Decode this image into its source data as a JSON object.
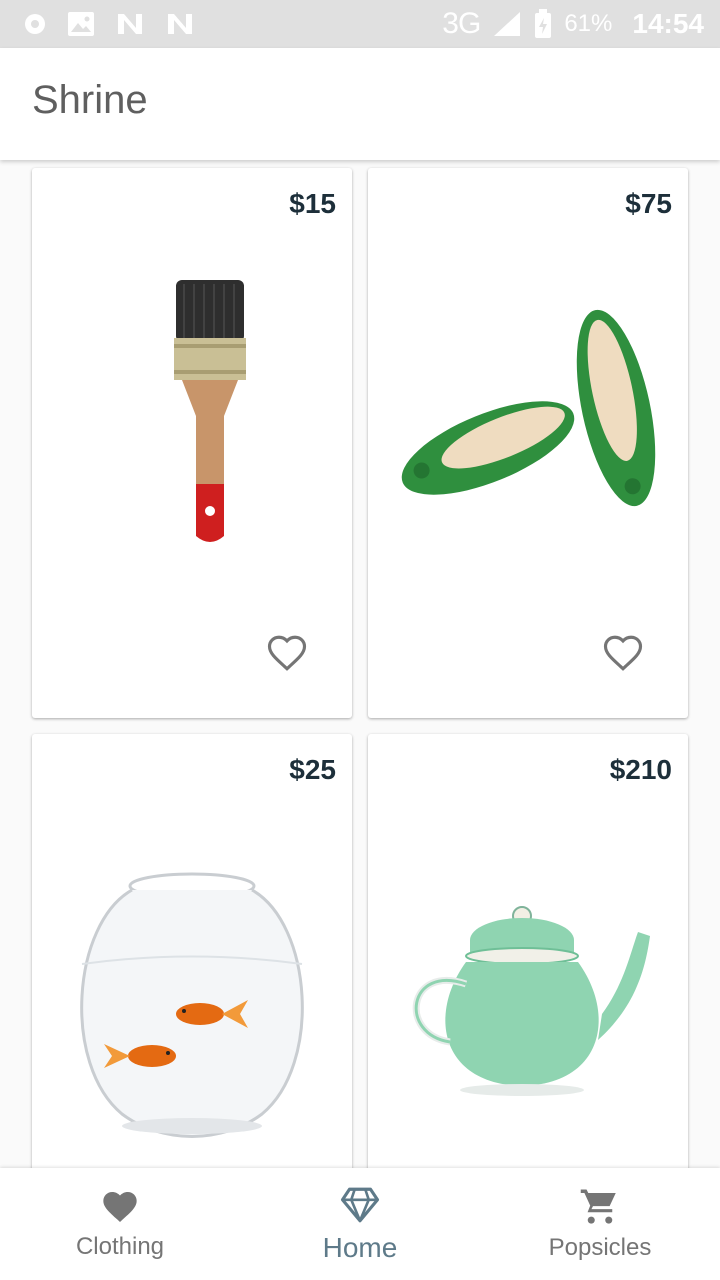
{
  "status_bar": {
    "network": "3G",
    "network_sup": "3G",
    "battery": "61%",
    "time": "14:54",
    "icons": [
      "record-icon",
      "image-icon",
      "n-icon",
      "n-icon"
    ]
  },
  "app_bar": {
    "title": "Shrine"
  },
  "products": [
    {
      "price": "$15",
      "name": "paint-brush",
      "icon": "heart-outline-icon"
    },
    {
      "price": "$75",
      "name": "green-flats",
      "icon": "heart-outline-icon"
    },
    {
      "price": "$25",
      "name": "goldfish-bowl",
      "icon": "heart-outline-icon"
    },
    {
      "price": "$210",
      "name": "green-teapot",
      "icon": "heart-outline-icon"
    }
  ],
  "bottom_nav": {
    "active": "Home",
    "items": [
      {
        "label": "Clothing",
        "icon": "heart-icon"
      },
      {
        "label": "Home",
        "icon": "diamond-icon"
      },
      {
        "label": "Popsicles",
        "icon": "cart-icon"
      }
    ]
  },
  "colors": {
    "status_bar": "#e0e0e0",
    "price": "#1d2f3a",
    "active_nav": "#5e7a89",
    "inactive_nav": "#757575"
  }
}
